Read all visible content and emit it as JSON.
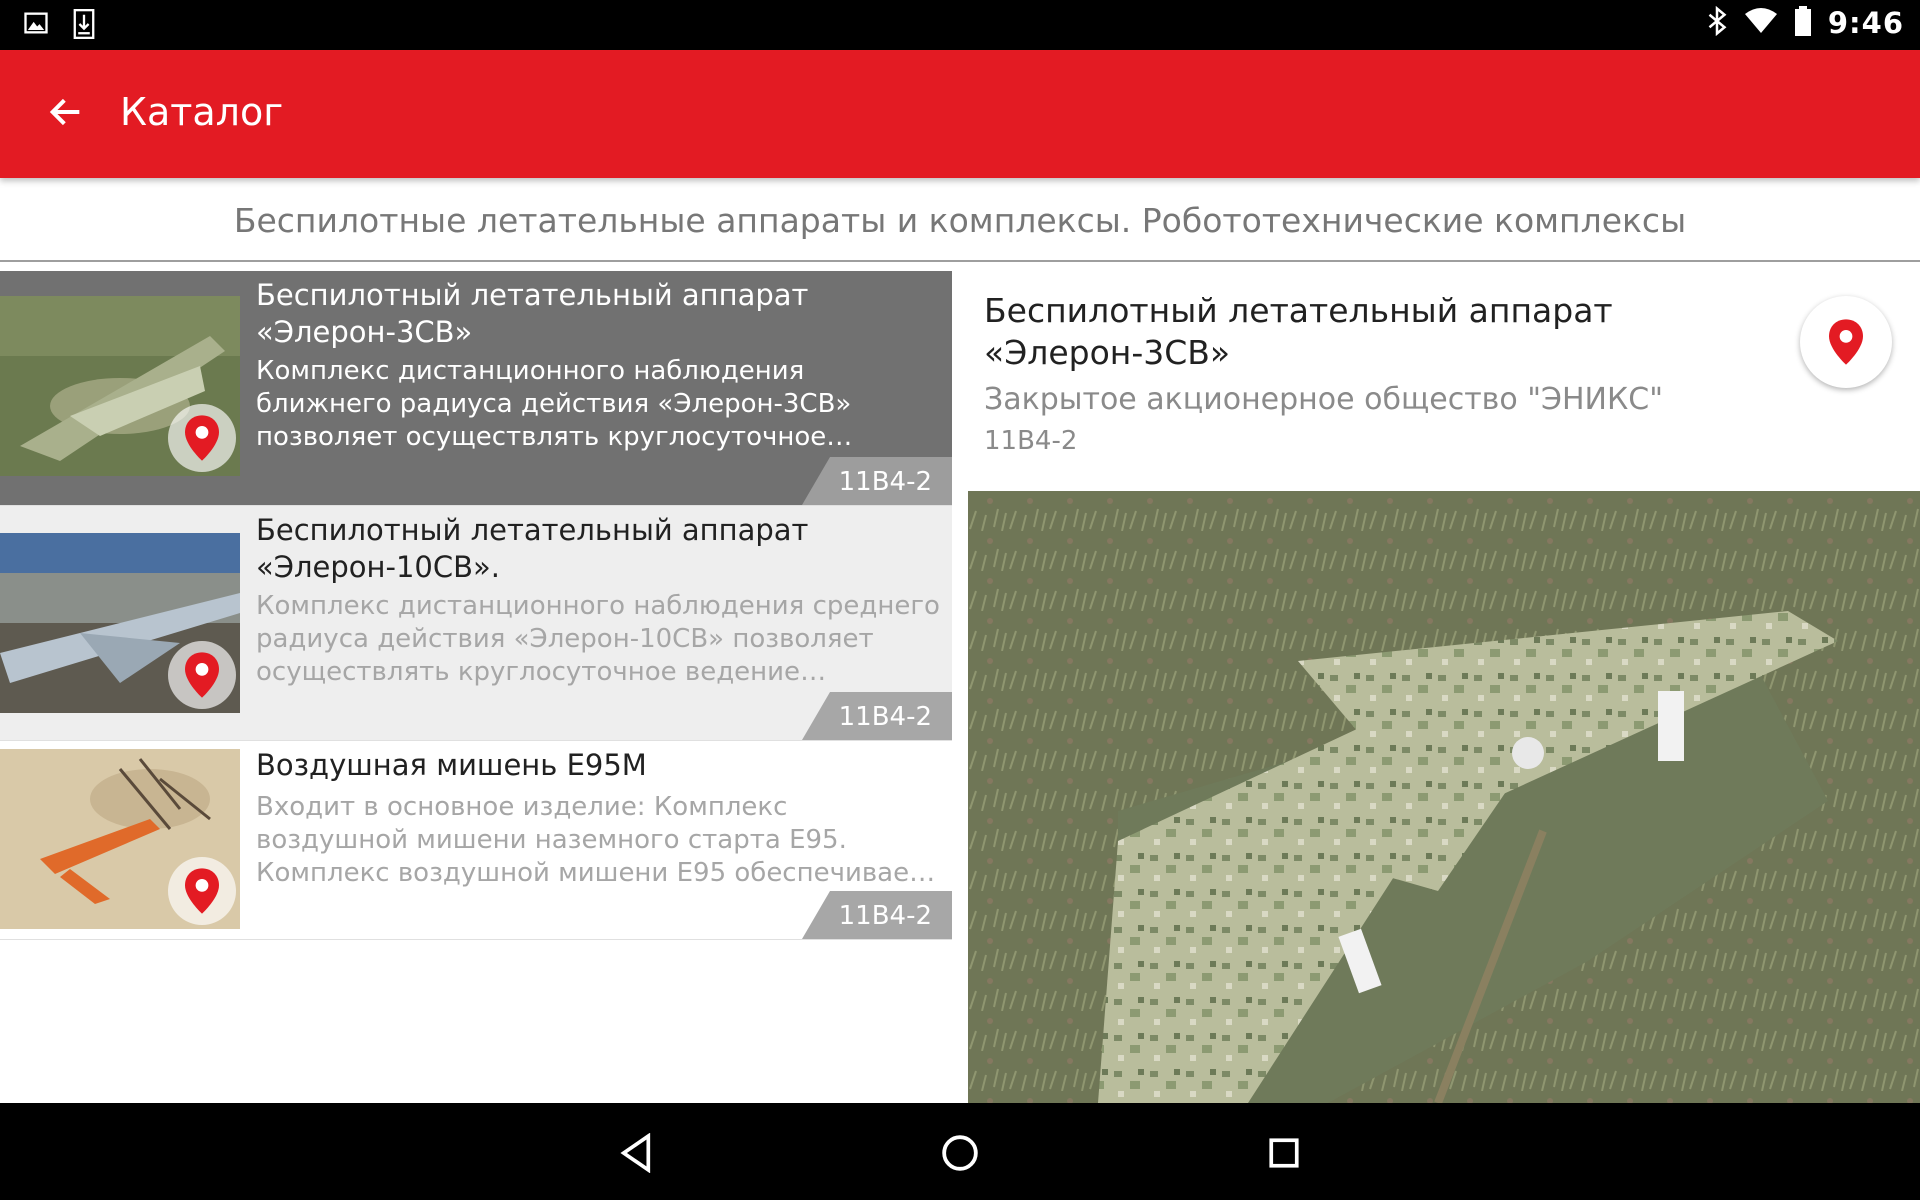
{
  "status_bar": {
    "time": "9:46"
  },
  "app_bar": {
    "title": "Каталог"
  },
  "category": {
    "title": "Беспилотные летательные аппараты и комплексы. Робототехнические комплексы"
  },
  "items": [
    {
      "title": "Беспилотный летательный аппарат «Элерон-3СВ»",
      "description": "Комплекс дистанционного наблюдения ближнего радиуса действия «Элерон-3СВ» позволяет осуществлять круглосуточное ведение воздушной…",
      "code": "11В4-2"
    },
    {
      "title": "Беспилотный летательный аппарат «Элерон-10СВ».",
      "description": "Комплекс дистанционного наблюдения среднего радиуса действия «Элерон-10СВ» позволяет осуществлять круглосуточное ведение воздушной…",
      "code": "11В4-2"
    },
    {
      "title": "Воздушная мишень Е95М",
      "description": "Входит в основное изделие: Комплекс воздушной мишени наземного старта Е95. Комплекс воздушной мишени Е95 обеспечивает решение задач по…",
      "code": "11В4-2"
    }
  ],
  "detail": {
    "title": "Беспилотный летательный аппарат «Элерон-3СВ»",
    "company": "Закрытое акционерное общество \"ЭНИКС\"",
    "code": "11В4-2"
  },
  "colors": {
    "accent": "#e31b23",
    "selected_row": "#717171",
    "alt_row": "#eeeeee",
    "badge": "#a7a7a7"
  },
  "icons": [
    "image-notification-icon",
    "download-notification-icon",
    "bluetooth-icon",
    "wifi-icon",
    "battery-icon",
    "back-arrow-icon",
    "map-pin-icon",
    "nav-back-icon",
    "nav-home-icon",
    "nav-recents-icon"
  ]
}
